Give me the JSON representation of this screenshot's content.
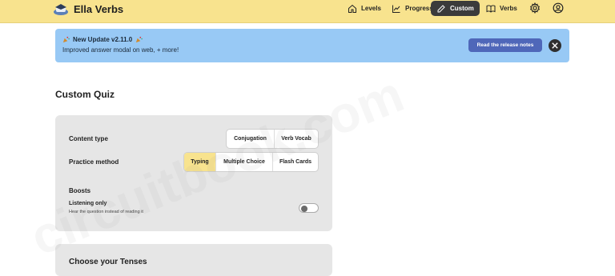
{
  "app": {
    "title": "Ella Verbs"
  },
  "nav": {
    "items": [
      {
        "label": "Levels",
        "icon": "home-icon"
      },
      {
        "label": "Progress",
        "icon": "chart-line-icon"
      },
      {
        "label": "Custom",
        "icon": "pencil-icon",
        "active": true
      },
      {
        "label": "Verbs",
        "icon": "book-icon"
      }
    ],
    "settings_icon": "gear-icon",
    "account_icon": "user-circle-icon"
  },
  "banner": {
    "title": "New Update v2.11.0",
    "text": "Improved answer modal on web, + more!",
    "button_label": "Read the release notes",
    "color": "#98c9f5"
  },
  "page": {
    "title": "Custom Quiz"
  },
  "settings": {
    "content_type": {
      "label": "Content type",
      "options": [
        "Conjugation",
        "Verb Vocab"
      ]
    },
    "practice_method": {
      "label": "Practice method",
      "options": [
        "Typing",
        "Multiple Choice",
        "Flash Cards"
      ],
      "selected": "Typing"
    },
    "boosts": {
      "label": "Boosts",
      "listening": {
        "label": "Listening only",
        "description": "Hear the question instead of reading it",
        "enabled": false
      }
    }
  },
  "tenses": {
    "title": "Choose your Tenses"
  },
  "watermark": {
    "text": "circuitbook.com"
  },
  "colors": {
    "topbar": "#f8e38e",
    "active_nav": "#3b3b3b",
    "release_button": "#4f67b9",
    "selected_option": "#f8e38e"
  }
}
